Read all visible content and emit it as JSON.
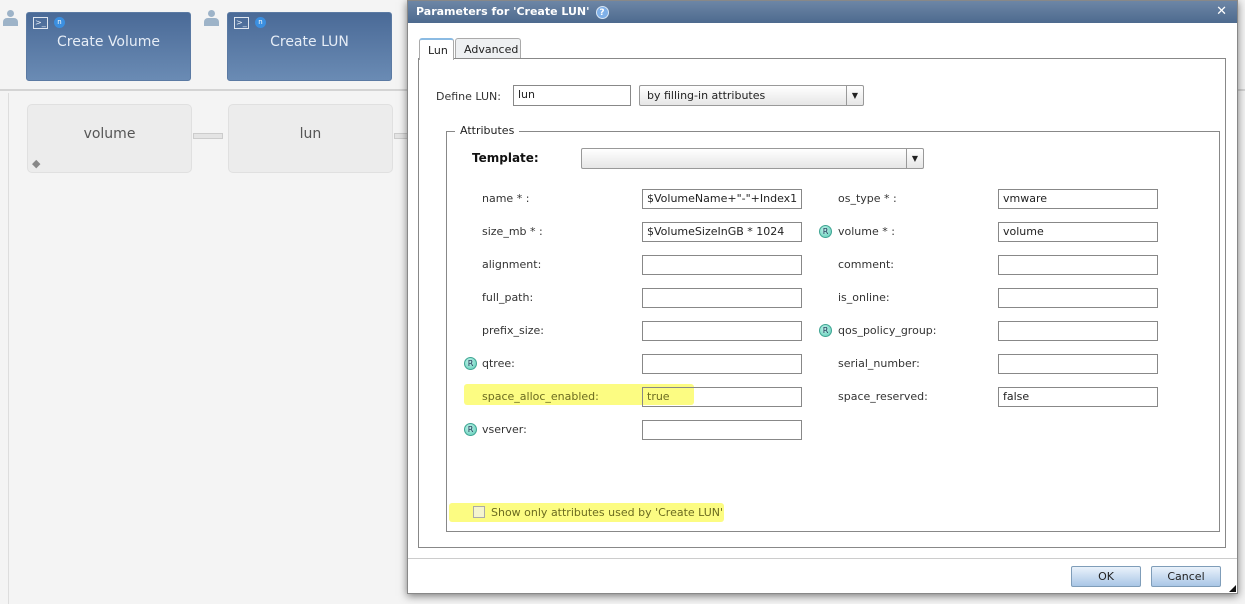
{
  "workflow": {
    "commands": [
      {
        "label": "Create Volume"
      },
      {
        "label": "Create LUN"
      }
    ],
    "nodes": [
      {
        "label": "volume"
      },
      {
        "label": "lun"
      }
    ]
  },
  "dialog": {
    "title": "Parameters for 'Create LUN'",
    "tabs": [
      {
        "label": "Lun",
        "active": true
      },
      {
        "label": "Advanced",
        "active": false
      }
    ],
    "define_label": "Define LUN:",
    "define_value": "lun",
    "define_mode": "by filling-in attributes",
    "attributes_legend": "Attributes",
    "template_label": "Template:",
    "template_value": "",
    "left_fields": [
      {
        "label": "name * :",
        "value": "$VolumeName+\"-\"+Index1",
        "r": false
      },
      {
        "label": "size_mb * :",
        "value": "$VolumeSizeInGB * 1024",
        "r": false
      },
      {
        "label": "alignment:",
        "value": "",
        "r": false
      },
      {
        "label": "full_path:",
        "value": "",
        "r": false
      },
      {
        "label": "prefix_size:",
        "value": "",
        "r": false
      },
      {
        "label": "qtree:",
        "value": "",
        "r": true
      },
      {
        "label": "space_alloc_enabled:",
        "value": "true",
        "r": false,
        "highlight": true
      },
      {
        "label": "vserver:",
        "value": "",
        "r": true
      }
    ],
    "right_fields": [
      {
        "label": "os_type * :",
        "value": "vmware",
        "r": false
      },
      {
        "label": "volume * :",
        "value": "volume",
        "r": true
      },
      {
        "label": "comment:",
        "value": "",
        "r": false
      },
      {
        "label": "is_online:",
        "value": "",
        "r": false
      },
      {
        "label": "qos_policy_group:",
        "value": "",
        "r": true
      },
      {
        "label": "serial_number:",
        "value": "",
        "r": false
      },
      {
        "label": "space_reserved:",
        "value": "false",
        "r": false
      }
    ],
    "r_badge": "R",
    "show_only_label": "Show only attributes used by 'Create LUN'",
    "show_only_checked": false,
    "ok_label": "OK",
    "cancel_label": "Cancel",
    "highlight_color": "#fbfb6c"
  }
}
